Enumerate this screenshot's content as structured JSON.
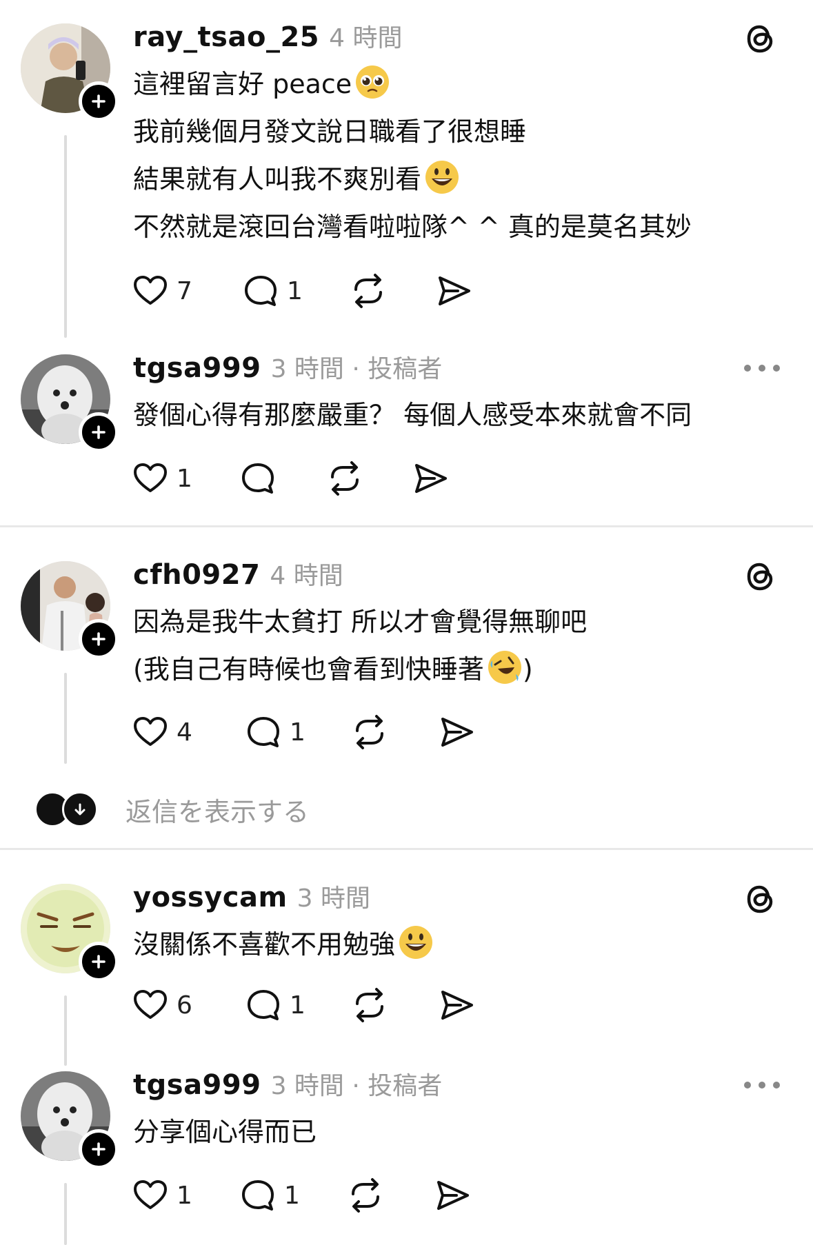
{
  "posts": [
    {
      "username": "ray_tsao_25",
      "meta": "4 時間",
      "corner": "threads",
      "lines": [
        "這裡留言好 peace",
        "我前幾個月發文說日職看了很想睡",
        "結果就有人叫我不爽別看",
        "不然就是滾回台灣看啦啦隊^ ^ 真的是莫名其妙"
      ],
      "likes": "7",
      "replies": "1"
    },
    {
      "username": "tgsa999",
      "meta": "3 時間 · 投稿者",
      "corner": "more",
      "lines": [
        "發個心得有那麼嚴重？ 每個人感受本來就會不同"
      ],
      "likes": "1",
      "replies": ""
    },
    {
      "username": "cfh0927",
      "meta": "4 時間",
      "corner": "threads",
      "lines": [
        "因為是我牛太貧打 所以才會覺得無聊吧",
        "(我自己有時候也會看到快睡著",
        ")"
      ],
      "likes": "4",
      "replies": "1"
    },
    {
      "username": "yossycam",
      "meta": "3 時間",
      "corner": "threads",
      "lines": [
        "沒關係不喜歡不用勉強"
      ],
      "likes": "6",
      "replies": "1"
    },
    {
      "username": "tgsa999",
      "meta": "3 時間 · 投稿者",
      "corner": "more",
      "lines": [
        "分享個心得而已"
      ],
      "likes": "1",
      "replies": "1"
    }
  ],
  "show_replies_label": "返信を表示する",
  "icons": {
    "follow": "plus-icon",
    "like": "heart-icon",
    "reply": "comment-icon",
    "repost": "repost-icon",
    "share": "send-icon",
    "threads": "threads-logo-icon",
    "more": "more-icon"
  }
}
